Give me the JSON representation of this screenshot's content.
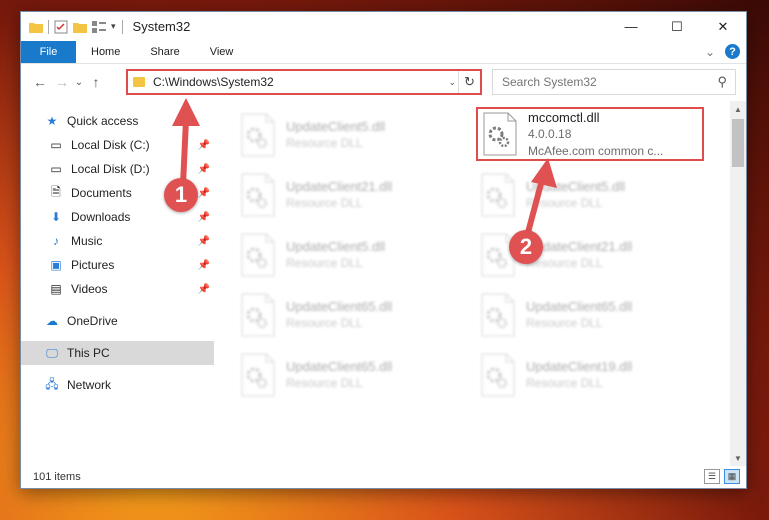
{
  "window": {
    "title": "System32",
    "controls": {
      "minimize": "—",
      "maximize": "☐",
      "close": "✕"
    }
  },
  "ribbon": {
    "tabs": [
      "File",
      "Home",
      "Share",
      "View"
    ],
    "expand": "⌄",
    "help": "?"
  },
  "nav": {
    "back": "←",
    "forward": "→",
    "recent": "⌄",
    "up": "↑",
    "address": "C:\\Windows\\System32",
    "address_dropdown": "⌄",
    "refresh": "↻",
    "search_placeholder": "Search System32"
  },
  "sidebar": {
    "quick_access": "Quick access",
    "pinned": [
      {
        "label": "Local Disk (C:)",
        "icon": "drive-icon"
      },
      {
        "label": "Local Disk (D:)",
        "icon": "drive-icon"
      },
      {
        "label": "Documents",
        "icon": "documents-icon"
      },
      {
        "label": "Downloads",
        "icon": "downloads-icon"
      },
      {
        "label": "Music",
        "icon": "music-icon"
      },
      {
        "label": "Pictures",
        "icon": "pictures-icon"
      },
      {
        "label": "Videos",
        "icon": "videos-icon"
      }
    ],
    "onedrive": "OneDrive",
    "this_pc": "This PC",
    "network": "Network"
  },
  "files": [
    {
      "name": "UpdateClient5.dll",
      "desc": "Resource DLL",
      "blurred": true
    },
    {
      "name": "mccomctl.dll",
      "version": "4.0.0.18",
      "desc": "McAfee.com common c...",
      "blurred": false
    },
    {
      "name": "UpdateClient21.dll",
      "desc": "Resource DLL",
      "blurred": true
    },
    {
      "name": "UpdateClient5.dll",
      "desc": "Resource DLL",
      "blurred": true
    },
    {
      "name": "UpdateClient5.dll",
      "desc": "Resource DLL",
      "blurred": true
    },
    {
      "name": "UpdateClient21.dll",
      "desc": "Resource DLL",
      "blurred": true
    },
    {
      "name": "UpdateClient65.dll",
      "desc": "Resource DLL",
      "blurred": true
    },
    {
      "name": "UpdateClient65.dll",
      "desc": "Resource DLL",
      "blurred": true
    },
    {
      "name": "UpdateClient65.dll",
      "desc": "Resource DLL",
      "blurred": true
    },
    {
      "name": "UpdateClient19.dll",
      "desc": "Resource DLL",
      "blurred": true
    }
  ],
  "status": {
    "count": "101 items"
  },
  "annotations": {
    "step1": "1",
    "step2": "2"
  },
  "colors": {
    "accent": "#1979ca",
    "highlight": "#e04b4b",
    "marker": "#e05252"
  }
}
